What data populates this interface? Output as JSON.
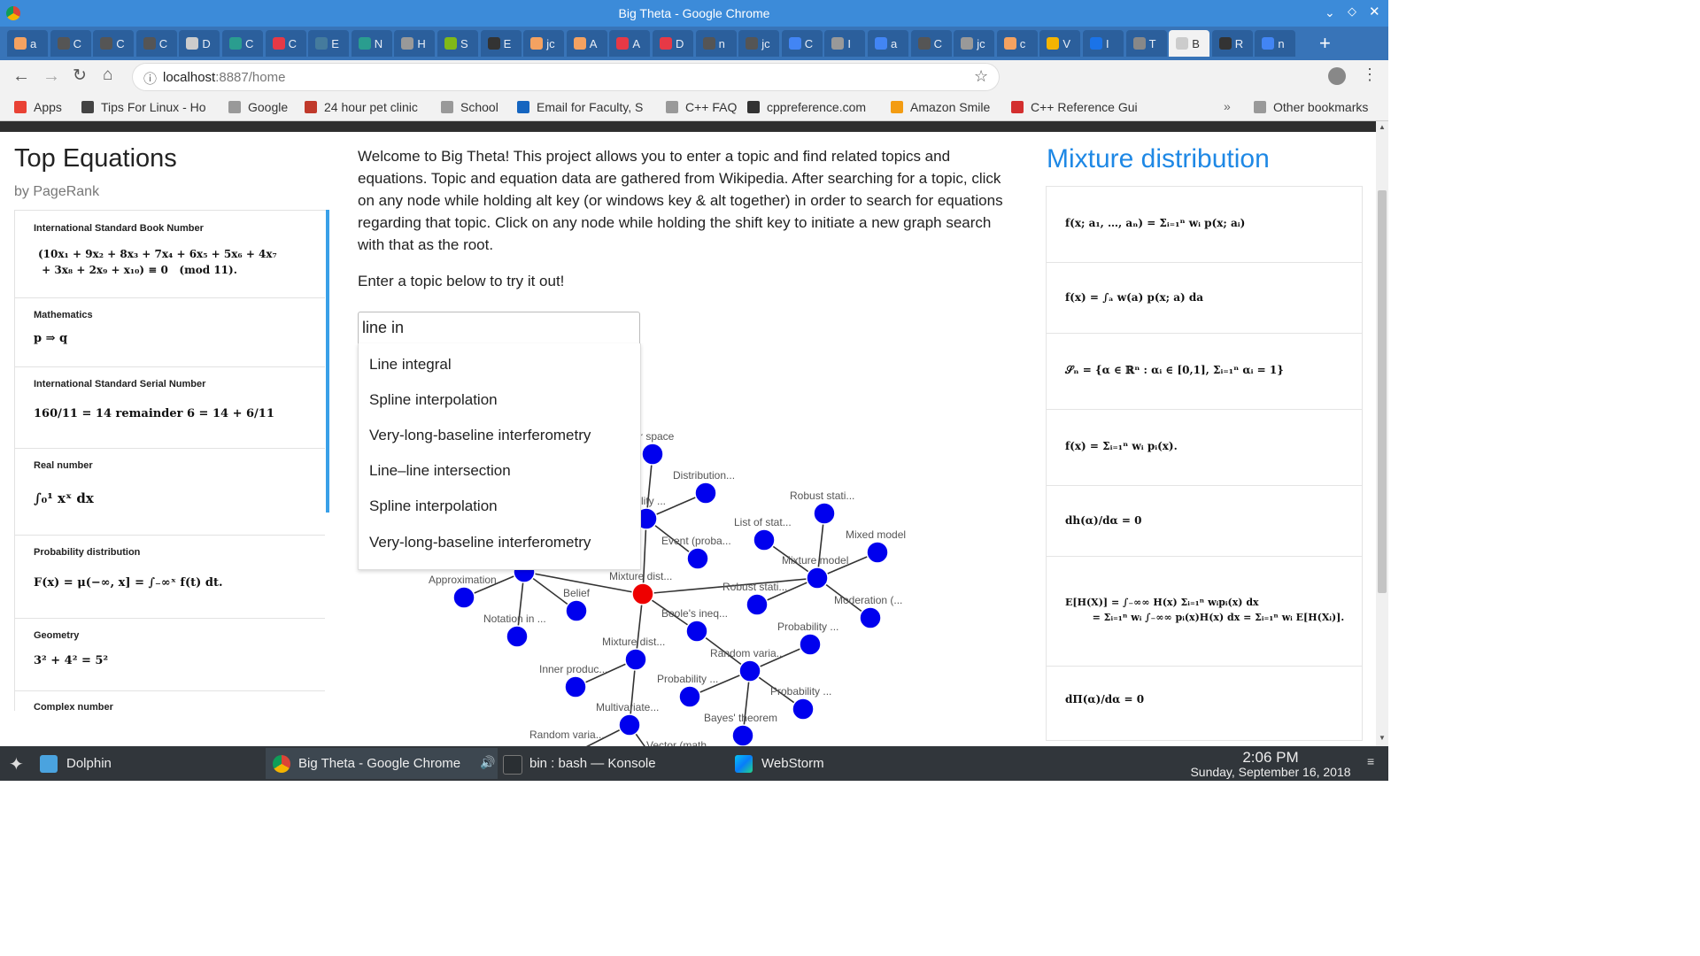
{
  "window": {
    "title": "Big Theta - Google Chrome"
  },
  "tabs": [
    "a",
    "C",
    "C",
    "C",
    "D",
    "C",
    "C",
    "E",
    "N",
    "H",
    "S",
    "E",
    "jc",
    "A",
    "A",
    "D",
    "n",
    "jc",
    "C",
    "I",
    "a",
    "C",
    "jc",
    "c",
    "V",
    "I",
    "T",
    "B",
    "R",
    "n"
  ],
  "address": {
    "host": "localhost",
    "path": ":8887/home"
  },
  "bookmarks": [
    "Apps",
    "Tips For Linux - Ho",
    "Google",
    "24 hour pet clinic",
    "School",
    "Email for Faculty, S",
    "C++ FAQ",
    "cppreference.com",
    "Amazon Smile",
    "C++ Reference Gui",
    "Other bookmarks"
  ],
  "left": {
    "title": "Top Equations",
    "subtitle": "by PageRank",
    "cards": [
      {
        "heading": "International Standard Book Number",
        "eq": "(10x₁ + 9x₂ + 8x₃ + 7x₄ + 6x₅ + 5x₆ + 4x₇\n + 3x₈ + 2x₉ + x₁₀) ≡ 0   (mod 11)."
      },
      {
        "heading": "Mathematics",
        "eq": "p ⇒ q"
      },
      {
        "heading": "International Standard Serial Number",
        "eq": "160/11 = 14 remainder 6 = 14 + 6/11"
      },
      {
        "heading": "Real number",
        "eq": "∫₀¹ xˣ dx"
      },
      {
        "heading": "Probability distribution",
        "eq": "F(x) = μ(−∞, x] = ∫₋∞ˣ f(t) dt."
      },
      {
        "heading": "Geometry",
        "eq": "3² + 4² = 5²"
      },
      {
        "heading": "Complex number",
        "eq": ""
      }
    ]
  },
  "main": {
    "intro": "Welcome to Big Theta! This project allows you to enter a topic and find related topics and equations. Topic and equation data are gathered from Wikipedia. After searching for a topic, click on any node while holding alt key (or windows key & alt together) in order to search for equations regarding that topic. Click on any node while holding the shift key to initiate a new graph search with that as the root.",
    "prompt": "Enter a topic below to try it out!",
    "search_value": "line in",
    "suggestions": [
      "Line integral",
      "Spline interpolation",
      "Very-long-baseline interferometry",
      "Line–line intersection",
      "Spline interpolation",
      "Very-long-baseline interferometry"
    ]
  },
  "graph": {
    "node_color": "#0000ee",
    "root_color": "#ee0000",
    "labels": [
      "tor space",
      "Distribution...",
      "ability ...",
      "Robust stati...",
      "List of stat...",
      "Mixed model",
      "Event (proba...",
      "Mixture model",
      "Approximation",
      "Mixture dist...",
      "Robust stati...",
      "Moderation (...",
      "Belief",
      "Notation in ...",
      "Boole's ineq...",
      "Probability ...",
      "Mixture dist...",
      "Random varia...",
      "Inner produc...",
      "Probability ...",
      "Probability ...",
      "Multivariate...",
      "Bayes' theorem",
      "Random varia...",
      "Vector (math..."
    ]
  },
  "right": {
    "title": "Mixture distribution",
    "cards": [
      "f(x; a₁, …, aₙ) = Σᵢ₌₁ⁿ wᵢ p(x; aᵢ)",
      "f(x) = ∫ₐ w(a) p(x; a) da",
      "𝒮ₙ = {α ∈ ℝⁿ : αᵢ ∈ [0,1], Σᵢ₌₁ⁿ αᵢ = 1}",
      "f(x) = Σᵢ₌₁ⁿ wᵢ pᵢ(x).",
      "dh(α)/dα = 0",
      "E[H(X)] = ∫₋∞∞ H(x) Σᵢ₌₁ⁿ wᵢpᵢ(x) dx\n        = Σᵢ₌₁ⁿ wᵢ ∫₋∞∞ pᵢ(x)H(x) dx = Σᵢ₌₁ⁿ wᵢ E[H(Xᵢ)].",
      "dΠ(α)/dα = 0"
    ]
  },
  "taskbar": {
    "items": [
      "Dolphin",
      "Big Theta - Google Chrome",
      "bin : bash — Konsole",
      "WebStorm"
    ],
    "time": "2:06 PM",
    "date": "Sunday, September 16, 2018"
  }
}
